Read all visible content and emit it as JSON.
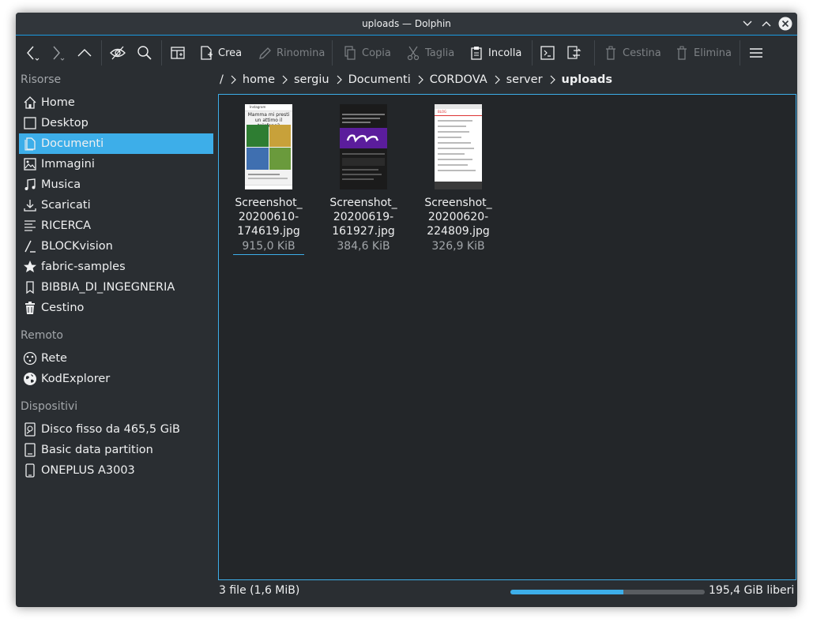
{
  "window": {
    "title": "uploads — Dolphin"
  },
  "toolbar": {
    "create": "Crea",
    "rename": "Rinomina",
    "copy": "Copia",
    "cut": "Taglia",
    "paste": "Incolla",
    "trash": "Cestina",
    "delete": "Elimina"
  },
  "sidebar": {
    "places_header": "Risorse",
    "places": [
      {
        "label": "Home",
        "icon": "home-icon"
      },
      {
        "label": "Desktop",
        "icon": "desktop-icon"
      },
      {
        "label": "Documenti",
        "icon": "documents-icon"
      },
      {
        "label": "Immagini",
        "icon": "pictures-icon"
      },
      {
        "label": "Musica",
        "icon": "music-icon"
      },
      {
        "label": "Scaricati",
        "icon": "downloads-icon"
      },
      {
        "label": "RICERCA",
        "icon": "list-icon"
      },
      {
        "label": "BLOCKvision",
        "icon": "slash-folder-icon"
      },
      {
        "label": "fabric-samples",
        "icon": "star-icon"
      },
      {
        "label": "BIBBIA_DI_INGEGNERIA",
        "icon": "bookmark-icon"
      },
      {
        "label": "Cestino",
        "icon": "trash-icon"
      }
    ],
    "remote_header": "Remoto",
    "remote": [
      {
        "label": "Rete",
        "icon": "network-icon"
      },
      {
        "label": "KodExplorer",
        "icon": "globe-icon"
      }
    ],
    "devices_header": "Dispositivi",
    "devices": [
      {
        "label": "Disco fisso da 465,5 GiB",
        "icon": "harddisk-icon"
      },
      {
        "label": "Basic data partition",
        "icon": "partition-icon"
      },
      {
        "label": "ONEPLUS A3003",
        "icon": "phone-icon"
      }
    ]
  },
  "breadcrumb": {
    "root": "/",
    "segments": [
      "home",
      "sergiu",
      "Documenti",
      "CORDOVA",
      "server"
    ],
    "current": "uploads"
  },
  "files": [
    {
      "name_lines": [
        "Screenshot_",
        "20200610-",
        "174619.jpg"
      ],
      "size": "915,0 KiB"
    },
    {
      "name_lines": [
        "Screenshot_",
        "20200619-",
        "161927.jpg"
      ],
      "size": "384,6 KiB"
    },
    {
      "name_lines": [
        "Screenshot_",
        "20200620-",
        "224809.jpg"
      ],
      "size": "326,9 KiB"
    }
  ],
  "thumbs": {
    "t1": {
      "header": "Instagram",
      "line1": "Mamma mi presti",
      "line2": "un attimo il telefono?"
    },
    "t3": {
      "header": "BLOG"
    }
  },
  "status": {
    "summary": "3 file (1,6 MiB)",
    "free": "195,4 GiB liberi",
    "used_fraction": 0.58
  },
  "colors": {
    "accent": "#3daee9",
    "window_bg": "#2a2e32",
    "view_bg": "#232629"
  }
}
